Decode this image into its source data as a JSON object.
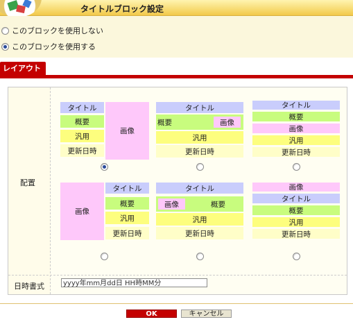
{
  "header": {
    "title": "タイトルブロック設定"
  },
  "block_usage": {
    "options": [
      "このブロックを使用しない",
      "このブロックを使用する"
    ],
    "selected": 1
  },
  "tab": {
    "label": "レイアウト"
  },
  "layout": {
    "label": "配置",
    "blocks": {
      "title": "タイトル",
      "summary": "概要",
      "image": "画像",
      "general": "汎用",
      "date": "更新日時"
    },
    "selected_option": 0
  },
  "date_format": {
    "label": "日時書式",
    "value": "yyyy年mm月dd日 HH時MM分"
  },
  "buttons": {
    "ok": "OK",
    "cancel": "キャンセル"
  },
  "colors": {
    "accent": "#c40000",
    "title_block": "#c9cdfc",
    "summary_block": "#c8fc7e",
    "image_block": "#fec8fa",
    "general_block": "#fdfe7e",
    "date_block": "#fffec8"
  }
}
